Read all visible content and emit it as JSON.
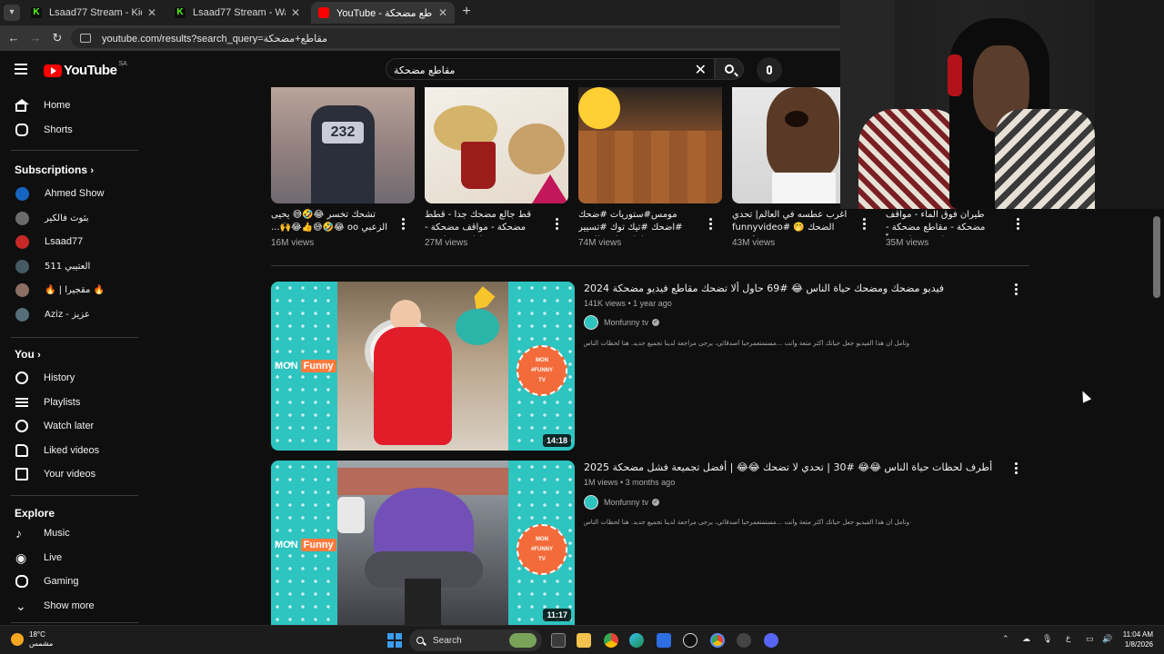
{
  "browser": {
    "tabs": [
      {
        "title": "Lsaad77 Stream - Kick Dashboard",
        "icon": "kick-icon"
      },
      {
        "title": "Lsaad77 Stream - Watch Live on Kick",
        "icon": "kick-icon"
      },
      {
        "title": "YouTube - مقاطع مضحكة",
        "icon": "youtube-icon"
      }
    ],
    "url": "youtube.com/results?search_query=مقاطع+مضحكة"
  },
  "header": {
    "logo_text": "YouTube",
    "country_code": "SA",
    "search_value": "مقاطع مضحكة"
  },
  "sidebar": {
    "main": [
      {
        "label": "Home",
        "icon": "home-icon"
      },
      {
        "label": "Shorts",
        "icon": "shorts-icon"
      }
    ],
    "subscriptions_title": "Subscriptions",
    "subscriptions": [
      {
        "label": "Ahmed Show",
        "color": "#1565c0"
      },
      {
        "label": "بثوث فالكير",
        "color": "#6b6b6b"
      },
      {
        "label": "Lsaad77",
        "color": "#c62828"
      },
      {
        "label": "العتيبي 511",
        "color": "#455a64"
      },
      {
        "label": "🔥 | مقجيرا 🔥",
        "color": "#8d6e63"
      },
      {
        "label": "Aziz - عزيز",
        "color": "#546e7a"
      }
    ],
    "you_title": "You",
    "you": [
      {
        "label": "History",
        "icon": "history-icon"
      },
      {
        "label": "Playlists",
        "icon": "playlists-icon"
      },
      {
        "label": "Watch later",
        "icon": "watch-later-icon"
      },
      {
        "label": "Liked videos",
        "icon": "thumbs-up-icon"
      },
      {
        "label": "Your videos",
        "icon": "your-videos-icon"
      }
    ],
    "explore_title": "Explore",
    "explore": [
      {
        "label": "Music",
        "icon": "music-icon"
      },
      {
        "label": "Live",
        "icon": "live-icon"
      },
      {
        "label": "Gaming",
        "icon": "gaming-icon"
      },
      {
        "label": "Show more",
        "icon": "chevron-down-icon"
      }
    ]
  },
  "shorts": [
    {
      "title": "تشحك تخسر 😂🤣😅 يحيى الزعبي oo 😂🤣😅👍😂🙌...",
      "views": "16M views"
    },
    {
      "title": "قط جالع مضحك جدا - قطط مضحكة - مواقف مضحكة - مقاطع مضحكة ...",
      "views": "27M views"
    },
    {
      "title": "مومس#ستوريات #ضحك #اضحك #تيك توك #تسيير #لايك #اشتراك ...",
      "views": "74M views"
    },
    {
      "title": "اغرب عطسه في العالم| تحدي الضحك 🤭 #funnyvideo #funny ...",
      "views": "43M views"
    },
    {
      "title": "طيران فوق الماء - مواقف مضحكة - مقاطع مضحكة - فيديوهات مضحكة جداً",
      "views": "35M views"
    }
  ],
  "videos": [
    {
      "title": "فيديو مضحك ومضحك حياة الناس 😂 #69 حاول ألا تضحك مقاطع فيديو مضحكة 2024",
      "meta": "141K views • 1 year ago",
      "channel": "Monfunny tv",
      "description": "وتأمل أن هذا الفيديو جعل حياتك أكثر متعة وأنت ...مستمتعمرحبا أصدقائي، يرجى مراجعة لدينا تجميع جديد. هنا لحظات الناس أشرطة الفيديو",
      "duration": "14:18"
    },
    {
      "title": "أطرف لحظات حياة الناس 😂😂 #30 | تحدي لا تضحك 😂😂 | أفضل تجميعة فشل مضحكة 2025",
      "meta": "1M views • 3 months ago",
      "channel": "Monfunny tv",
      "description": "وتأمل أن هذا الفيديو جعل حياتك أكثر متعة وأنت ...مستمتعمرحبا أصدقائي، يرجى مراجعة لدينا تجميع جديد. هنا لحظات الناس أشرطة الفيديو",
      "duration": "11:17"
    }
  ],
  "thumb_brand": {
    "mon": "MON",
    "funny": "Funny",
    "tv": "tv",
    "badge_top": "MON",
    "badge_mid": "#FUNNY",
    "badge_bot": "TV"
  },
  "taskbar": {
    "temp": "18°C",
    "weather_label": "مشمس",
    "search_label": "Search",
    "time": "11:04 AM",
    "date": "1/8/2026",
    "lang": "ع"
  },
  "colors": {
    "accent": "#ff0000",
    "thumb_teal": "#2ec4c0",
    "badge_orange": "#f36b3b"
  }
}
